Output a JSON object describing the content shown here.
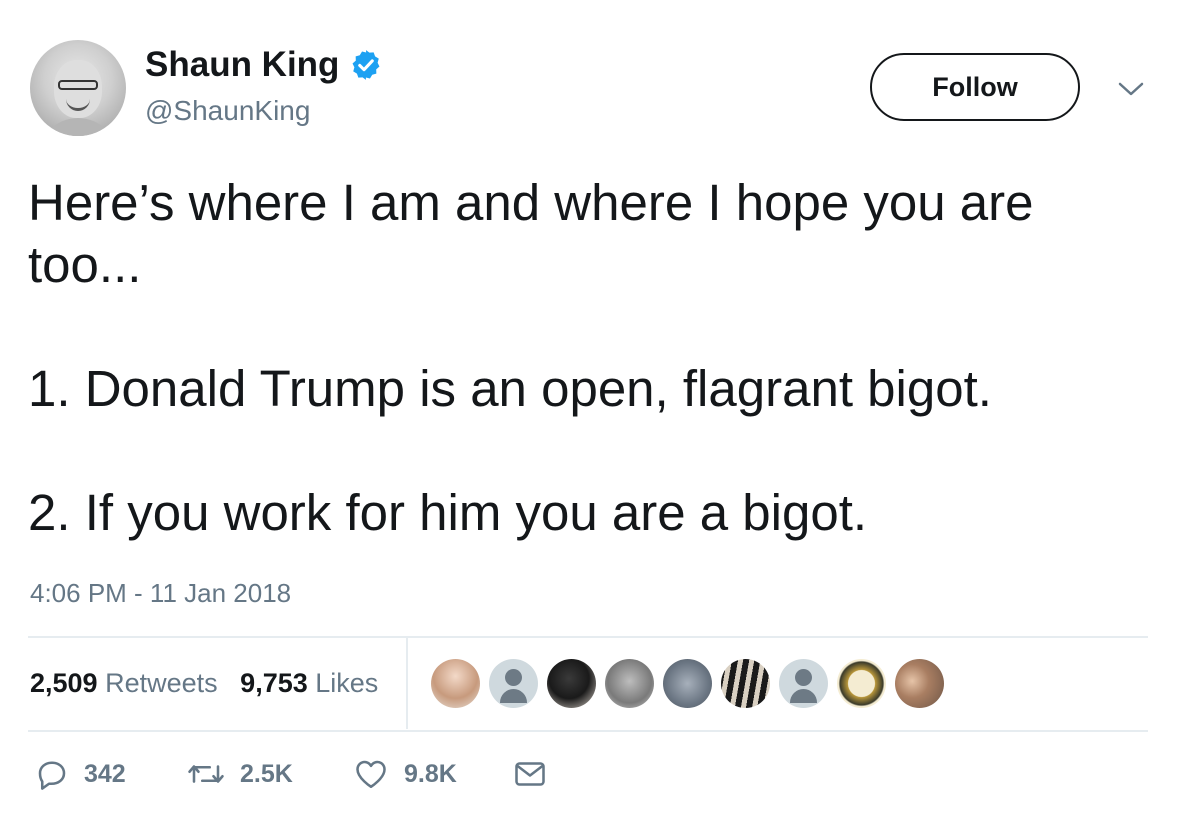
{
  "author": {
    "name": "Shaun King",
    "handle": "@ShaunKing",
    "verified": true
  },
  "follow_button": {
    "label": "Follow"
  },
  "tweet": {
    "text": "Here’s where I am and where I hope you are too...\n\n1. Donald Trump is an open, flagrant bigot.\n\n2. If you work for him you are a bigot.",
    "timestamp": "4:06 PM - 11 Jan 2018"
  },
  "stats": {
    "retweets_count": "2,509",
    "retweets_label": "Retweets",
    "likes_count": "9,753",
    "likes_label": "Likes"
  },
  "actions": {
    "reply_count": "342",
    "retweet_count": "2.5K",
    "like_count": "9.8K"
  },
  "colors": {
    "text": "#14171a",
    "secondary": "#657786",
    "verified": "#1da1f2",
    "divider": "#e6ecf0"
  }
}
